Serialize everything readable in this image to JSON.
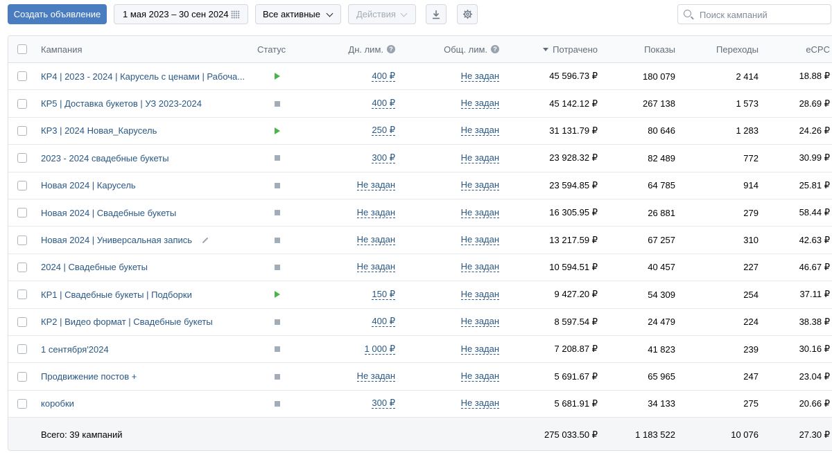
{
  "toolbar": {
    "create_label": "Создать объявление",
    "date_range": "1 мая 2023 – 30 сен 2024",
    "filter": "Все активные",
    "actions": "Действия",
    "search_placeholder": "Поиск кампаний"
  },
  "table": {
    "headers": {
      "campaign": "Кампания",
      "status": "Статус",
      "daily_limit": "Дн. лим.",
      "total_limit": "Общ. лим.",
      "spent": "Потрачено",
      "shows": "Показы",
      "clicks": "Переходы",
      "ecpc": "eCPC"
    },
    "rows": [
      {
        "name": "КР4 | 2023 - 2024 | Карусель с ценами | Рабоча...",
        "status": "active",
        "daily": "400 ₽",
        "total": "Не задан",
        "spent": "45 596.73 ₽",
        "shows": "180 079",
        "clicks": "2 414",
        "ecpc": "18.88 ₽"
      },
      {
        "name": "КР5 | Доставка букетов | УЗ 2023-2024",
        "status": "stopped",
        "daily": "400 ₽",
        "total": "Не задан",
        "spent": "45 142.12 ₽",
        "shows": "267 138",
        "clicks": "1 573",
        "ecpc": "28.69 ₽"
      },
      {
        "name": "КР3 | 2024 Новая_Карусель",
        "status": "active",
        "daily": "250 ₽",
        "total": "Не задан",
        "spent": "31 131.79 ₽",
        "shows": "80 646",
        "clicks": "1 283",
        "ecpc": "24.26 ₽"
      },
      {
        "name": "2023 - 2024 свадебные букеты",
        "status": "stopped",
        "daily": "300 ₽",
        "total": "Не задан",
        "spent": "23 928.32 ₽",
        "shows": "82 489",
        "clicks": "772",
        "ecpc": "30.99 ₽"
      },
      {
        "name": "Новая 2024 | Карусель",
        "status": "stopped",
        "daily": "Не задан",
        "total": "Не задан",
        "spent": "23 594.85 ₽",
        "shows": "64 785",
        "clicks": "914",
        "ecpc": "25.81 ₽"
      },
      {
        "name": "Новая 2024 | Свадебные букеты",
        "status": "stopped",
        "daily": "Не задан",
        "total": "Не задан",
        "spent": "16 305.95 ₽",
        "shows": "26 881",
        "clicks": "279",
        "ecpc": "58.44 ₽"
      },
      {
        "name": "Новая 2024 | Универсальная запись",
        "status": "stopped",
        "daily": "Не задан",
        "total": "Не задан",
        "spent": "13 217.59 ₽",
        "shows": "67 257",
        "clicks": "310",
        "ecpc": "42.63 ₽",
        "editable": true
      },
      {
        "name": "2024 | Свадебные букеты",
        "status": "stopped",
        "daily": "Не задан",
        "total": "Не задан",
        "spent": "10 594.51 ₽",
        "shows": "40 457",
        "clicks": "227",
        "ecpc": "46.67 ₽"
      },
      {
        "name": "КР1 | Свадебные букеты | Подборки",
        "status": "active",
        "daily": "150 ₽",
        "total": "Не задан",
        "spent": "9 427.20 ₽",
        "shows": "54 309",
        "clicks": "254",
        "ecpc": "37.11 ₽"
      },
      {
        "name": "КР2 | Видео формат | Свадебные букеты",
        "status": "stopped",
        "daily": "400 ₽",
        "total": "Не задан",
        "spent": "8 597.54 ₽",
        "shows": "24 479",
        "clicks": "224",
        "ecpc": "38.38 ₽"
      },
      {
        "name": "1 сентября'2024",
        "status": "stopped",
        "daily": "1 000 ₽",
        "total": "Не задан",
        "spent": "7 208.87 ₽",
        "shows": "41 823",
        "clicks": "239",
        "ecpc": "30.16 ₽"
      },
      {
        "name": "Продвижение постов +",
        "status": "stopped",
        "daily": "Не задан",
        "total": "Не задан",
        "spent": "5 691.67 ₽",
        "shows": "65 965",
        "clicks": "247",
        "ecpc": "23.04 ₽"
      },
      {
        "name": "коробки",
        "status": "stopped",
        "daily": "300 ₽",
        "total": "Не задан",
        "spent": "5 681.91 ₽",
        "shows": "34 133",
        "clicks": "275",
        "ecpc": "20.66 ₽"
      }
    ],
    "totals": {
      "label": "Всего: 39 кампаний",
      "spent": "275 033.50 ₽",
      "shows": "1 183 522",
      "clicks": "10 076",
      "ecpc": "27.30 ₽"
    }
  },
  "colors": {
    "primary": "#4a7dbf",
    "link": "#2a5885",
    "active_status": "#4bb34b",
    "stopped_status": "#a3adb8"
  }
}
